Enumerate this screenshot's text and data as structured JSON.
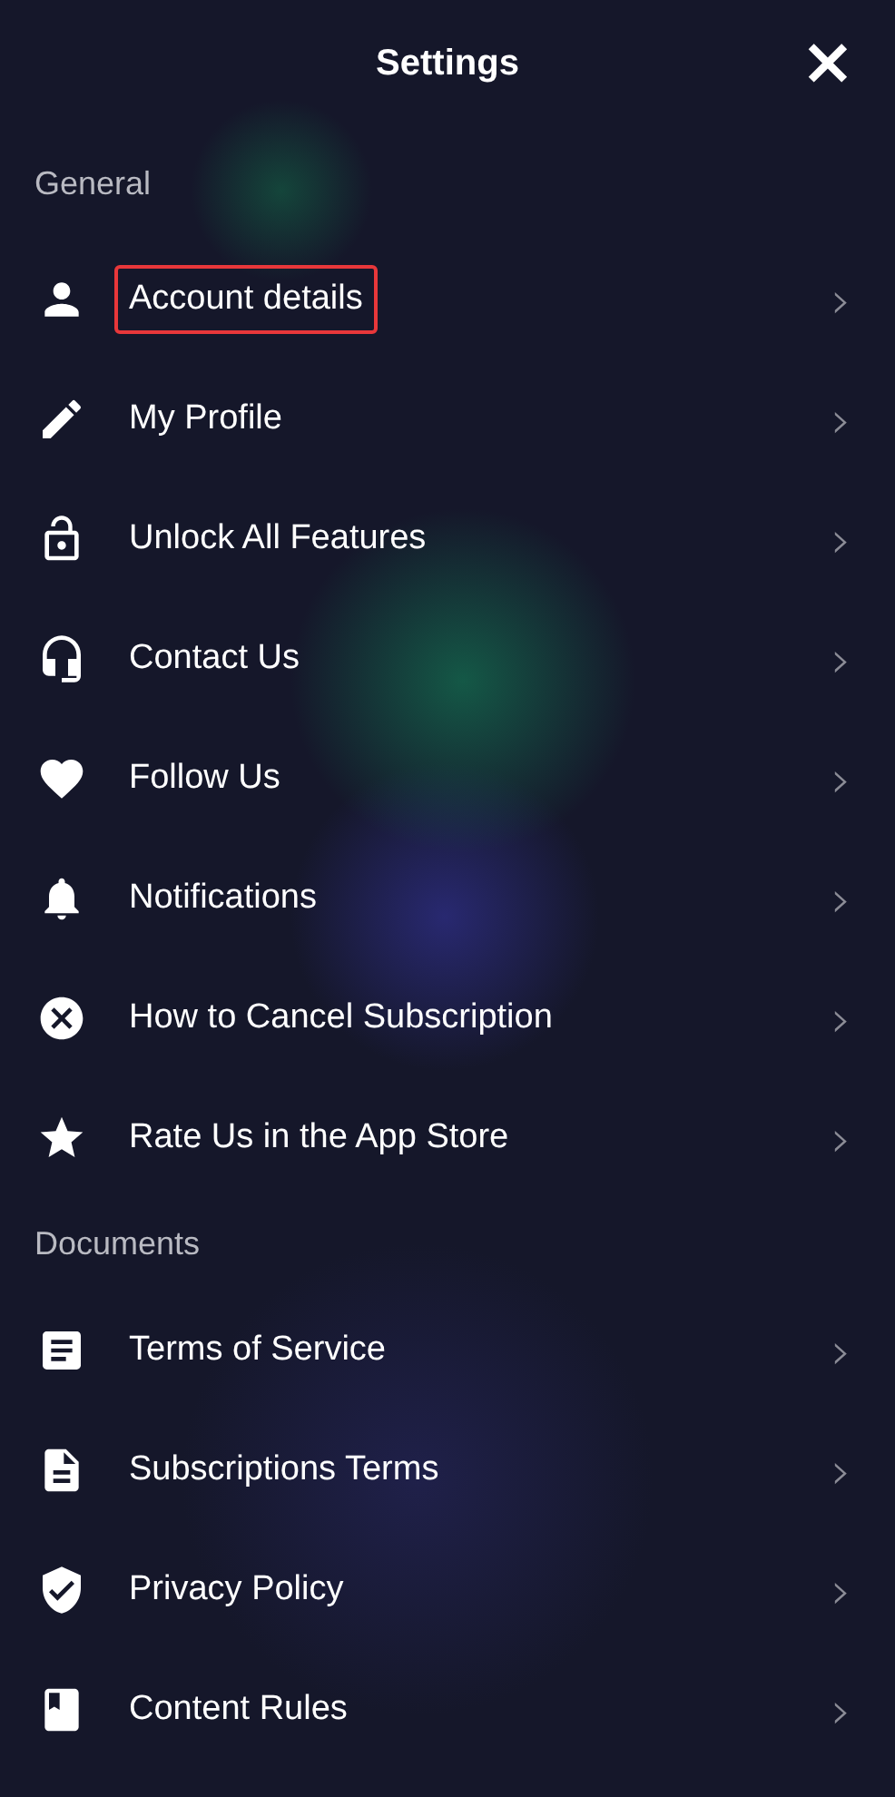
{
  "header": {
    "title": "Settings",
    "close": "×"
  },
  "sections": [
    {
      "label": "General",
      "items": [
        {
          "label": "Account details",
          "highlighted": true,
          "chevron": "›"
        },
        {
          "label": "My Profile",
          "highlighted": false,
          "chevron": "›"
        },
        {
          "label": "Unlock All Features",
          "highlighted": false,
          "chevron": "›"
        },
        {
          "label": "Contact Us",
          "highlighted": false,
          "chevron": "›"
        },
        {
          "label": "Follow Us",
          "highlighted": false,
          "chevron": "›"
        },
        {
          "label": "Notifications",
          "highlighted": false,
          "chevron": "›"
        },
        {
          "label": "How to Cancel Subscription",
          "highlighted": false,
          "chevron": "›"
        },
        {
          "label": "Rate Us in the App Store",
          "highlighted": false,
          "chevron": "›"
        }
      ]
    },
    {
      "label": "Documents",
      "items": [
        {
          "label": "Terms of Service",
          "highlighted": false,
          "chevron": "›"
        },
        {
          "label": "Subscriptions Terms",
          "highlighted": false,
          "chevron": "›"
        },
        {
          "label": "Privacy Policy",
          "highlighted": false,
          "chevron": "›"
        },
        {
          "label": "Content Rules",
          "highlighted": false,
          "chevron": "›"
        }
      ]
    }
  ]
}
